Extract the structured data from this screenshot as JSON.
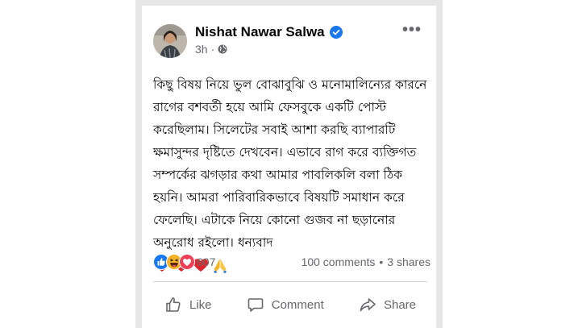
{
  "post": {
    "author": "Nishat Nawar Salwa",
    "time": "3h",
    "separator": "·",
    "audience_icon": "globe-icon",
    "verified_icon": "verified-badge-icon",
    "more_label": "•••",
    "text": "কিছু বিষয় নিয়ে ভুল বোঝাবুঝি ও মনোমালিন্যের কারনে রাগের বশবর্তী হয়ে আমি ফেসবুকে একটি পোস্ট করেছিলাম। সিলেটের সবাই আশা করছি ব্যাপারটি ক্ষমাসুন্দর দৃষ্টিতে দেখবেন। এভাবে রাগ করে ব্যক্তিগত সম্পর্কের ঝগড়ার কথা আমার পাবলিকলি বলা ঠিক হয়নি। আমরা পারিবারিকভাবে বিষয়টি সমাধান করে ফেলেছি। এটাকে নিয়ে কোনো গুজব না ছড়ানোর অনুরোধ রইলো। ধন্যবাদ",
    "emojis": [
      "heart",
      "heart",
      "heart",
      "folded-hands"
    ]
  },
  "reactions": {
    "icons": [
      "like",
      "haha",
      "love"
    ],
    "count": "607",
    "comments": "100 comments",
    "shares_separator": "•",
    "shares": "3 shares"
  },
  "actions": {
    "like": "Like",
    "comment": "Comment",
    "share": "Share"
  },
  "colors": {
    "brand_blue": "#1877f2",
    "love_red": "#f33e58",
    "haha_yellow": "#f7b125",
    "secondary_text": "#65676b"
  }
}
